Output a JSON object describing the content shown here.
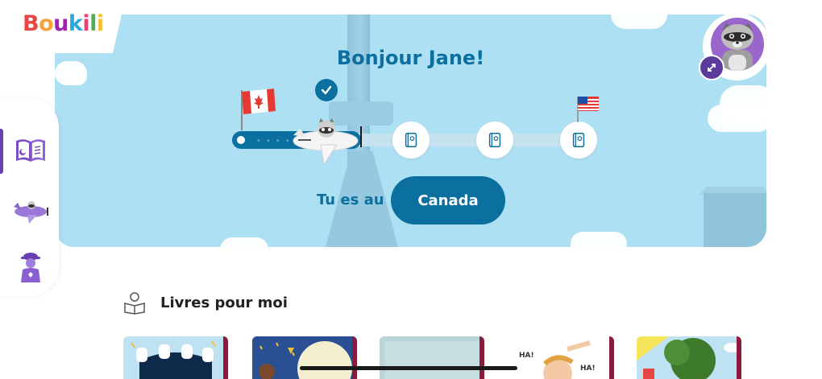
{
  "app": {
    "logo_letters": [
      {
        "ch": "B",
        "color": "#e84545"
      },
      {
        "ch": "o",
        "color": "#f2a33a"
      },
      {
        "ch": "u",
        "color": "#9c27b0"
      },
      {
        "ch": "k",
        "color": "#29a9e1"
      },
      {
        "ch": "i",
        "color": "#ef3e7a"
      },
      {
        "ch": "l",
        "color": "#4caf50"
      },
      {
        "ch": "i",
        "color": "#f2c230"
      }
    ]
  },
  "hero": {
    "greeting": "Bonjour Jane!",
    "location_prefix": "Tu es au",
    "location_name": "Canada",
    "stops": [
      {
        "name": "book-stop-1",
        "icon": "book-icon"
      },
      {
        "name": "book-stop-2",
        "icon": "book-icon"
      },
      {
        "name": "book-stop-3",
        "icon": "book-icon"
      }
    ],
    "colors": {
      "sky": "#aee0f3",
      "accent": "#0b6f9f"
    }
  },
  "sidebar": {
    "items": [
      {
        "name": "sidebar-item-books",
        "icon": "open-book-icon",
        "active": true
      },
      {
        "name": "sidebar-item-journey",
        "icon": "airplane-icon",
        "active": false
      },
      {
        "name": "sidebar-item-character",
        "icon": "character-icon",
        "active": false
      }
    ]
  },
  "section": {
    "title": "Livres pour moi",
    "books": [
      {
        "name": "book-card-1"
      },
      {
        "name": "book-card-2"
      },
      {
        "name": "book-card-3"
      },
      {
        "name": "book-card-4"
      },
      {
        "name": "book-card-5"
      }
    ]
  }
}
